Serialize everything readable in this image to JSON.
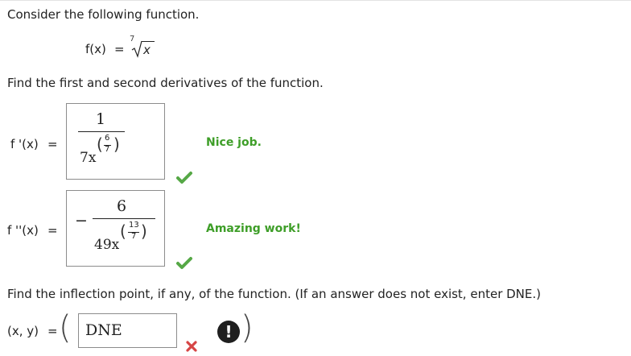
{
  "problem": {
    "intro": "Consider the following function.",
    "function": {
      "lhs": "f(x)",
      "equals": "=",
      "root_index": "7",
      "radicand": "x"
    },
    "derivatives_prompt": "Find the first and second derivatives of the function."
  },
  "first_derivative": {
    "label": "f '(x)",
    "equals": "=",
    "answer": {
      "numerator": "1",
      "denominator_base": "7x",
      "exponent_numerator": "6",
      "exponent_denominator": "7"
    },
    "feedback": "Nice job.",
    "status_icon": "check-icon"
  },
  "second_derivative": {
    "label": "f ''(x)",
    "equals": "=",
    "answer": {
      "sign": "−",
      "numerator": "6",
      "denominator_base": "49x",
      "exponent_numerator": "13",
      "exponent_denominator": "7"
    },
    "feedback": "Amazing work!",
    "status_icon": "check-icon"
  },
  "inflection": {
    "prompt": "Find the inflection point, if any, of the function. (If an answer does not exist, enter DNE.)",
    "label": "(x, y)",
    "equals": "=",
    "open_paren": "(",
    "close_paren": ")",
    "input_value": "DNE",
    "status_icon": "cross-icon",
    "alert_icon": "exclamation-icon",
    "alert_symbol": "!"
  },
  "colors": {
    "correct_green": "#3e9e28",
    "wrong_red": "#d64545",
    "alert_dark": "#1f1f1f"
  }
}
